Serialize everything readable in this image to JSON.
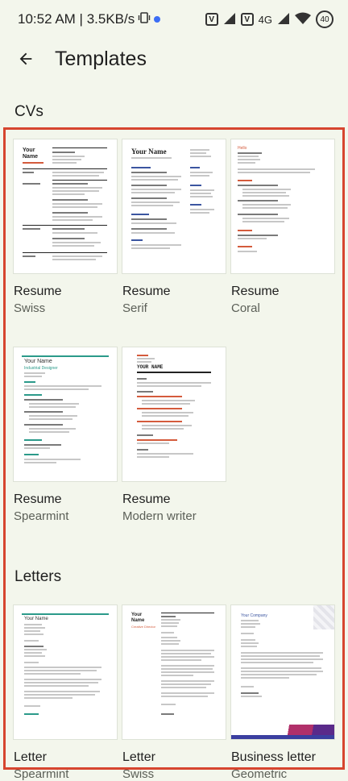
{
  "status_bar": {
    "time_speed": "10:52 AM | 3.5KB/s",
    "icons": [
      "vibrate-icon",
      "vpn-icon",
      "signal-icon",
      "wifi-icon",
      "battery-icon"
    ],
    "network": "4G",
    "battery": "40"
  },
  "app_bar": {
    "title": "Templates",
    "back_icon": "arrow-back-icon"
  },
  "sections": [
    {
      "title": "CVs",
      "templates": [
        {
          "title": "Resume",
          "subtitle": "Swiss",
          "thumb_name": "Your Name"
        },
        {
          "title": "Resume",
          "subtitle": "Serif",
          "thumb_name": "Your Name"
        },
        {
          "title": "Resume",
          "subtitle": "Coral",
          "thumb_name": "Hello"
        },
        {
          "title": "Resume",
          "subtitle": "Spearmint",
          "thumb_name": "Your Name",
          "thumb_role": "Industrial Designer"
        },
        {
          "title": "Resume",
          "subtitle": "Modern writer",
          "thumb_name": "YOUR NAME"
        }
      ]
    },
    {
      "title": "Letters",
      "templates": [
        {
          "title": "Letter",
          "subtitle": "Spearmint",
          "thumb_name": "Your Name"
        },
        {
          "title": "Letter",
          "subtitle": "Swiss",
          "thumb_name": "Your Name",
          "thumb_role": "Creative Director"
        },
        {
          "title": "Business letter",
          "subtitle": "Geometric",
          "thumb_name": "Your Company"
        }
      ]
    }
  ],
  "colors": {
    "accent_highlight": "#d6452f",
    "background": "#f3f6ec",
    "spearmint": "#2b9a8a",
    "swiss": "#d45b3c"
  }
}
